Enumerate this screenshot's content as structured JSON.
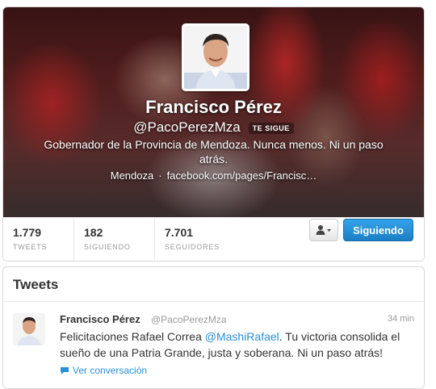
{
  "profile": {
    "name": "Francisco Pérez",
    "handle": "@PacoPerezMza",
    "follows_you": "TE SIGUE",
    "bio": "Gobernador de la Provincia de Mendoza. Nunca menos. Ni un paso atrás.",
    "location": "Mendoza",
    "separator": "·",
    "website": "facebook.com/pages/Francisc…"
  },
  "stats": [
    {
      "value": "1.779",
      "label": "TWEETS"
    },
    {
      "value": "182",
      "label": "SIGUIENDO"
    },
    {
      "value": "7.701",
      "label": "SEGUIDORES"
    }
  ],
  "actions": {
    "person_menu_icon": "person-dropdown-icon",
    "follow_label": "Siguiendo"
  },
  "tweets_section": {
    "title": "Tweets",
    "items": [
      {
        "name": "Francisco Pérez",
        "handle": "@PacoPerezMza",
        "time": "34 min",
        "text_before": "Felicitaciones Rafael Correa ",
        "mention": "@MashiRafael",
        "text_after": ". Tu victoria consolida el sueño de una Patria Grande, justa y soberana. Ni un paso atrás!",
        "conversation_label": "Ver conversación"
      }
    ]
  },
  "colors": {
    "link": "#2a8fd5",
    "follow_button": "#2b96dc",
    "muted": "#999999"
  }
}
